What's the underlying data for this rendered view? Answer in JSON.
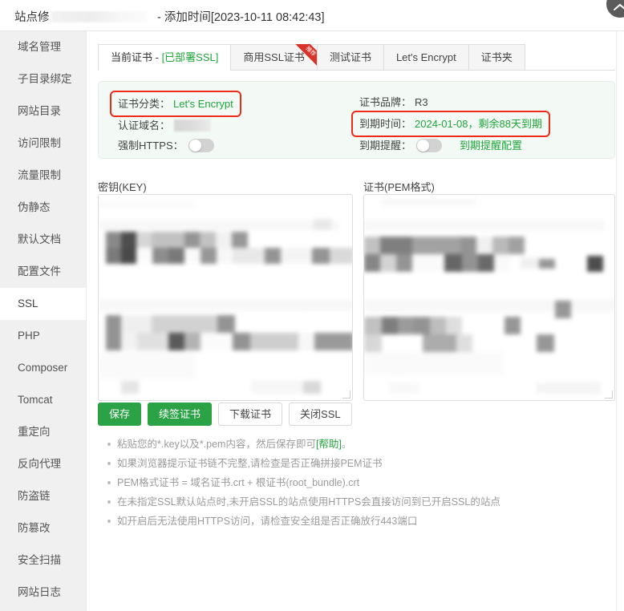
{
  "window": {
    "title_prefix": "站点修",
    "title_suffix": "- 添加时间[2023-10-11 08:42:43]",
    "close_icon": "close-icon"
  },
  "sidebar": {
    "items": [
      {
        "label": "域名管理",
        "active": false
      },
      {
        "label": "子目录绑定",
        "active": false
      },
      {
        "label": "网站目录",
        "active": false
      },
      {
        "label": "访问限制",
        "active": false
      },
      {
        "label": "流量限制",
        "active": false
      },
      {
        "label": "伪静态",
        "active": false
      },
      {
        "label": "默认文档",
        "active": false
      },
      {
        "label": "配置文件",
        "active": false
      },
      {
        "label": "SSL",
        "active": true
      },
      {
        "label": "PHP",
        "active": false
      },
      {
        "label": "Composer",
        "active": false
      },
      {
        "label": "Tomcat",
        "active": false
      },
      {
        "label": "重定向",
        "active": false
      },
      {
        "label": "反向代理",
        "active": false
      },
      {
        "label": "防盗链",
        "active": false
      },
      {
        "label": "防篡改",
        "active": false
      },
      {
        "label": "安全扫描",
        "active": false
      },
      {
        "label": "网站日志",
        "active": false
      }
    ]
  },
  "tabs": [
    {
      "label": "当前证书 - ",
      "status": "[已部署SSL]",
      "active": true,
      "ribbon": null
    },
    {
      "label": "商用SSL证书",
      "status": "",
      "active": false,
      "ribbon": "推荐"
    },
    {
      "label": "测试证书",
      "status": "",
      "active": false,
      "ribbon": null
    },
    {
      "label": "Let's Encrypt",
      "status": "",
      "active": false,
      "ribbon": null
    },
    {
      "label": "证书夹",
      "status": "",
      "active": false,
      "ribbon": null
    }
  ],
  "cert_info": {
    "category_label": "证书分类：",
    "category_value": "Let's Encrypt",
    "domain_label": "认证域名：",
    "domain_value_redacted": true,
    "force_https_label": "强制HTTPS：",
    "force_https_on": false,
    "brand_label": "证书品牌：",
    "brand_value": "R3",
    "expiry_label": "到期时间：",
    "expiry_value": "2024-01-08，剩余88天到期",
    "remind_label": "到期提醒：",
    "remind_on": false,
    "remind_config_link": "到期提醒配置"
  },
  "editors": {
    "key_label": "密钥(KEY)",
    "key_value_redacted": true,
    "pem_label": "证书(PEM格式)",
    "pem_value_redacted": true
  },
  "buttons": [
    {
      "label": "保存",
      "style": "green"
    },
    {
      "label": "续签证书",
      "style": "green"
    },
    {
      "label": "下载证书",
      "style": "white"
    },
    {
      "label": "关闭SSL",
      "style": "white"
    }
  ],
  "help": {
    "line1_a": "粘贴您的*.key以及*.pem内容，然后保存即可",
    "line1_link": "[帮助]",
    "line1_b": "。",
    "line2": "如果浏览器提示证书链不完整,请检查是否正确拼接PEM证书",
    "line3": "PEM格式证书 = 域名证书.crt + 根证书(root_bundle).crt",
    "line4": "在未指定SSL默认站点时,未开启SSL的站点使用HTTPS会直接访问到已开启SSL的站点",
    "line5": "如开启后无法使用HTTPS访问，请检查安全组是否正确放行443端口"
  },
  "colors": {
    "accent_green": "#20a53a",
    "button_green": "#2ba245",
    "highlight_red": "#ee2b19",
    "panel_bg": "#f3faf5",
    "sidebar_bg": "#f0f0f0"
  }
}
